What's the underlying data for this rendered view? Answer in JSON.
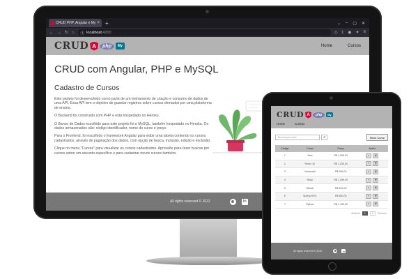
{
  "browser": {
    "tab_title": "CRUD PHP, Angular e My",
    "url_host": "localhost",
    "url_port": ":4200"
  },
  "site": {
    "logo_text": "CRUD",
    "php_badge": "php",
    "mysql_badge": "My",
    "nav": [
      "Home",
      "Cursos"
    ],
    "title": "CRUD com Angular, PHP e MySQL",
    "section_title": "Cadastro de Cursos",
    "paragraphs": [
      "Este projeto foi desenvolvido como parte de um treinamento de criação e consumo de dados de uma API. Essa API tem o objetivo de guardar registros sobre cursos ofertados por uma plataforma de ensino.",
      "O Backend foi construído com PHP e está hospedado no Heroku.",
      "O Banco de Dados escolhido para este projeto foi o MySQL, também hospedado no Heroku. Os dados armazenados são: código identificador, nome do curso e preço.",
      "Para o Frontend, foi escolhido o framework Angular para exibir uma tabela contendo os cursos cadastrados, através de paginação dos dados, com opção de busca, inclusão, edição e exclusão.",
      "Clique no menu \"Cursos\" para visualizar os cursos cadastrados. Aproveite para fazer buscas por cursos sobre um assunto específico e para cadastrar novos cursos também."
    ],
    "footer": "All rights reserved © 2022"
  },
  "tablet": {
    "nav": [
      "Home",
      "Cursos"
    ],
    "search_placeholder": "Buscar por curso",
    "new_button": "Novo Curso",
    "columns": [
      "Código",
      "Curso",
      "Preço",
      "Ações"
    ],
    "rows": [
      {
        "code": "1",
        "course": "Java",
        "price": "R$ 1.599,00"
      },
      {
        "code": "2",
        "course": "React JS",
        "price": "R$ 1.250,00"
      },
      {
        "code": "3",
        "course": "Javascript",
        "price": "R$ 999,00"
      },
      {
        "code": "4",
        "course": "Ruby",
        "price": "R$ 1.399,00"
      },
      {
        "code": "5",
        "course": "Github",
        "price": "R$ 499,00"
      },
      {
        "code": "6",
        "course": "Spring MVC",
        "price": "R$ 850,00"
      },
      {
        "code": "7",
        "course": "Python",
        "price": "R$ 1.150,00"
      }
    ],
    "pager": {
      "prev": "Anterior",
      "pages": [
        "1",
        "2"
      ],
      "next": "Próximo"
    },
    "footer": "All rights reserved © 2022"
  }
}
